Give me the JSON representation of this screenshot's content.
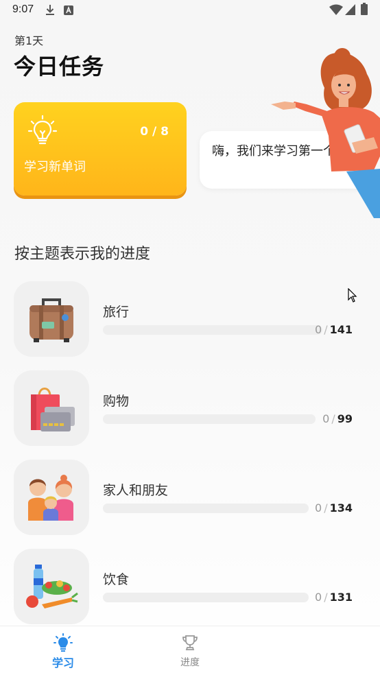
{
  "status_bar": {
    "time": "9:07"
  },
  "header": {
    "day": "第1天",
    "title": "今日任务"
  },
  "task_card": {
    "progress": "0 / 8",
    "label": "学习新单词",
    "gradient": [
      "#ffd21f",
      "#ffb51a"
    ]
  },
  "speech_bubble": {
    "text": "嗨，我们来学习第一个词"
  },
  "section_title": "按主题表示我的进度",
  "topics": [
    {
      "name": "旅行",
      "done": "0",
      "total": "141",
      "icon": "suitcase-icon",
      "progress": 0
    },
    {
      "name": "购物",
      "done": "0",
      "total": "99",
      "icon": "shopping-bag-icon",
      "progress": 0
    },
    {
      "name": "家人和朋友",
      "done": "0",
      "total": "134",
      "icon": "family-icon",
      "progress": 0
    },
    {
      "name": "饮食",
      "done": "0",
      "total": "131",
      "icon": "food-icon",
      "progress": 0
    }
  ],
  "bottom_nav": {
    "items": [
      {
        "label": "学习",
        "icon": "lightbulb-icon",
        "active": true
      },
      {
        "label": "进度",
        "icon": "trophy-icon",
        "active": false
      }
    ]
  },
  "colors": {
    "accent": "#2a8be8",
    "card": "#ffc21a"
  }
}
